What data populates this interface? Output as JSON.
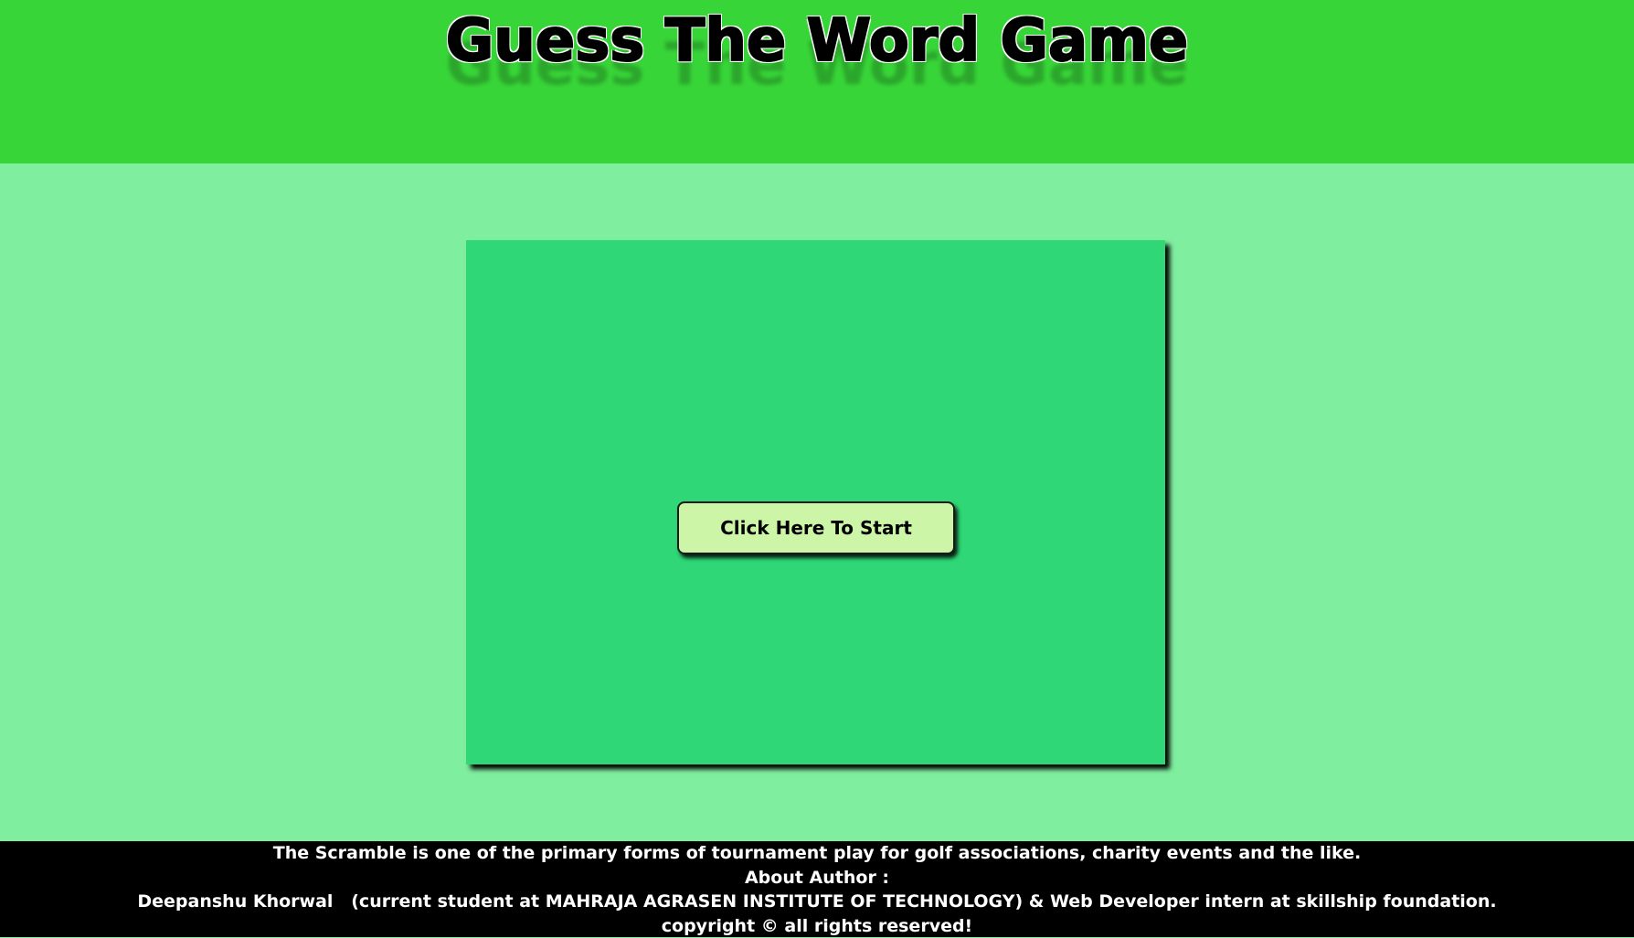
{
  "header": {
    "title": "Guess The Word Game"
  },
  "game": {
    "start_button_label": "Click Here To Start"
  },
  "footer": {
    "description": "The Scramble is one of the primary forms of tournament play for golf associations, charity events and the like.",
    "about_heading": "About Author :",
    "author_line": "Deepanshu Khorwal   (current student at MAHRAJA AGRASEN INSTITUTE OF TECHNOLOGY) & Web Developer intern at skillship foundation.",
    "copyright": "copyright © all rights reserved!"
  },
  "colors": {
    "header_bg": "#38d538",
    "page_bg": "#7fee9f",
    "game_box_bg": "#2fd776",
    "button_bg": "#ccf5a8",
    "footer_bg": "#000000",
    "footer_text": "#ffffff"
  }
}
